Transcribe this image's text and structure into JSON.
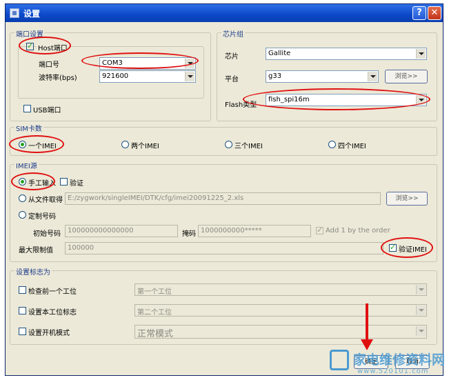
{
  "window": {
    "title": "设置",
    "help": "?",
    "close": "✕"
  },
  "port": {
    "legend": "端口设置",
    "host_label": "Host端口",
    "host_checked": true,
    "port_label": "端口号",
    "port_value": "COM3",
    "baud_label": "波特率(bps)",
    "baud_value": "921600",
    "usb_label": "USB端口",
    "usb_checked": false
  },
  "chip": {
    "legend": "芯片组",
    "chip_label": "芯片",
    "chip_value": "Gallite",
    "platform_label": "平台",
    "platform_value": "g33",
    "browse_label": "浏览>>",
    "flash_label": "Flash类型",
    "flash_value": "fish_spi16m"
  },
  "sim": {
    "legend": "SIM卡数",
    "options": [
      "一个IMEI",
      "两个IMEI",
      "三个IMEI",
      "四个IMEI"
    ],
    "selected": 0
  },
  "imei": {
    "legend": "IMEI源",
    "manual_label": "手工输入",
    "verify_label": "验证",
    "file_label": "从文件取得",
    "file_path": "E:/zygwork/singleIMEI/DTK/cfg/imei20091225_2.xls",
    "browse_label": "浏览>>",
    "custom_label": "定制号码",
    "start_label": "初始号码",
    "start_value": "100000000000000",
    "mask_label": "掩码",
    "mask_value": "1000000000*****",
    "add_label": "Add 1 by the order",
    "max_label": "最大限制值",
    "max_value": "100000",
    "verify_imei_label": "验证IMEI"
  },
  "flags": {
    "legend": "设置标志为",
    "rows": [
      {
        "label": "检查前一个工位",
        "value": "第一个工位"
      },
      {
        "label": "设置本工位标志",
        "value": "第二个工位"
      },
      {
        "label": "设置开机模式",
        "value": "正常模式"
      }
    ]
  },
  "footer": {
    "ok_label": "确定",
    "cancel_label": "取消"
  },
  "watermark": {
    "text": "家电维修资料网",
    "url": "www.520101.com"
  },
  "colors": {
    "highlight": "#e01010",
    "titlebar": "#0b48c9"
  }
}
